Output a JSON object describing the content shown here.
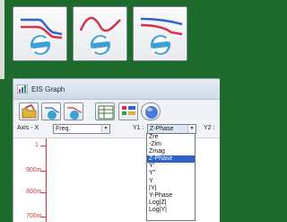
{
  "colors": {
    "background_green": "#1e6a2c",
    "selection_blue": "#2a62c9",
    "axis_red": "#d23a3a"
  },
  "top_buttons": [
    {
      "icon": "lowpass-curve-swap-icon"
    },
    {
      "icon": "wave-curve-swap-icon"
    },
    {
      "icon": "decay-curve-swap-icon"
    }
  ],
  "window": {
    "title": "EIS Graph"
  },
  "toolbar": {
    "buttons": [
      {
        "icon": "open-folder-icon"
      },
      {
        "icon": "graph-swap-icon"
      },
      {
        "icon": "graph-swap-alt-icon"
      },
      {
        "icon": "table-view-icon"
      },
      {
        "icon": "color-legend-icon"
      },
      {
        "icon": "sphere-icon"
      }
    ]
  },
  "axis_bar": {
    "x_label": "Axis - X",
    "x_value": "Freq.",
    "y1_label": "Y1 :",
    "y1_value": "Z-Phase",
    "y2_label": "Y2 :"
  },
  "plot": {
    "y_ticks": [
      "1",
      "900m",
      "800m",
      "700m"
    ]
  },
  "dropdown": {
    "options": [
      "Zre",
      "-Zim",
      "Zmag",
      "Z-Phase",
      "Y'",
      "Y''",
      "Y",
      "|Y|",
      "Y-Phase",
      "Log|Z|",
      "Log|Y|"
    ],
    "selected": "Z-Phase"
  }
}
